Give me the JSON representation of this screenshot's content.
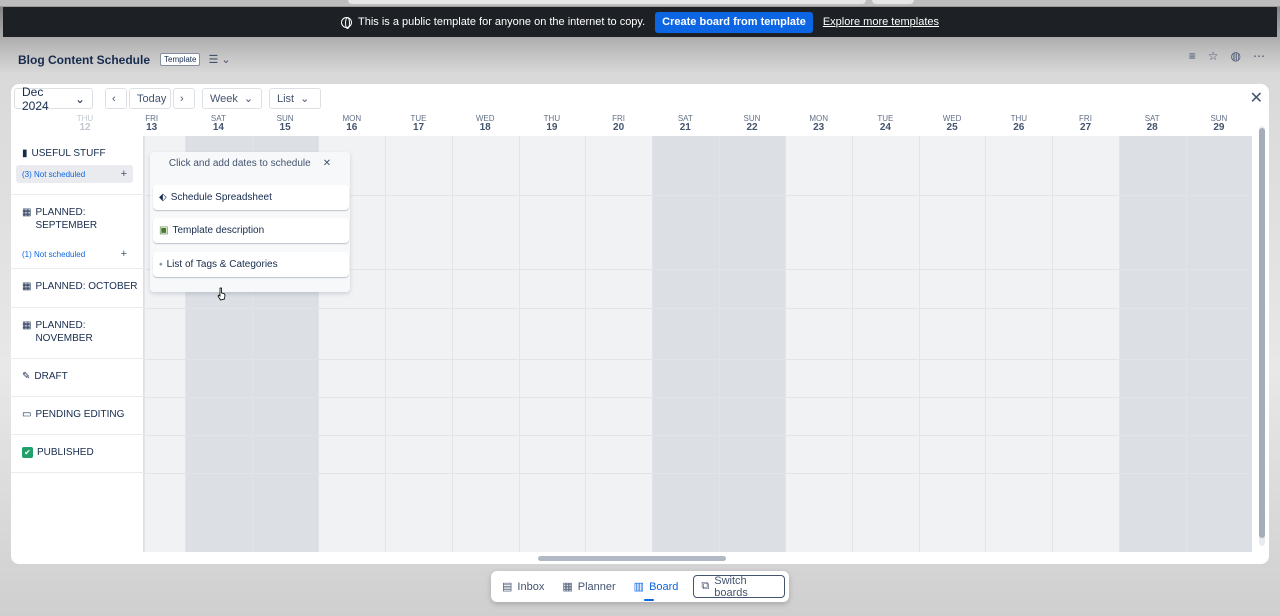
{
  "banner": {
    "message": "This is a public template for anyone on the internet to copy.",
    "create_label": "Create board from template",
    "explore_label": "Explore more templates"
  },
  "board": {
    "title": "Blog Content Schedule",
    "badge": "Template"
  },
  "toolbar": {
    "month": "Dec 2024",
    "today": "Today",
    "view": "Week",
    "mode": "List"
  },
  "days": [
    {
      "d": "THU",
      "n": "12"
    },
    {
      "d": "FRI",
      "n": "13"
    },
    {
      "d": "SAT",
      "n": "14"
    },
    {
      "d": "SUN",
      "n": "15"
    },
    {
      "d": "MON",
      "n": "16"
    },
    {
      "d": "TUE",
      "n": "17"
    },
    {
      "d": "WED",
      "n": "18"
    },
    {
      "d": "THU",
      "n": "19"
    },
    {
      "d": "FRI",
      "n": "20"
    },
    {
      "d": "SAT",
      "n": "21"
    },
    {
      "d": "SUN",
      "n": "22"
    },
    {
      "d": "MON",
      "n": "23"
    },
    {
      "d": "TUE",
      "n": "24"
    },
    {
      "d": "WED",
      "n": "25"
    },
    {
      "d": "THU",
      "n": "26"
    },
    {
      "d": "FRI",
      "n": "27"
    },
    {
      "d": "SAT",
      "n": "28"
    },
    {
      "d": "SUN",
      "n": "29"
    }
  ],
  "lanes": [
    {
      "icon": "▮",
      "title": "USEFUL STUFF",
      "not_scheduled": "(3) Not scheduled"
    },
    {
      "icon": "▦",
      "title": "PLANNED: SEPTEMBER",
      "not_scheduled": "(1) Not scheduled"
    },
    {
      "icon": "▦",
      "title": "PLANNED: OCTOBER"
    },
    {
      "icon": "▦",
      "title": "PLANNED: NOVEMBER"
    },
    {
      "icon": "✎",
      "title": "DRAFT"
    },
    {
      "icon": "▭",
      "title": "PENDING EDITING"
    },
    {
      "icon": "✔",
      "title": "PUBLISHED"
    }
  ],
  "popup": {
    "hint": "Click and add dates to schedule",
    "cards": [
      {
        "icon": "⬖",
        "label": "Schedule Spreadsheet"
      },
      {
        "icon": "▣",
        "label": "Template description"
      },
      {
        "icon": "⬩",
        "label": "List of Tags & Categories"
      }
    ]
  },
  "nav": {
    "inbox": "Inbox",
    "planner": "Planner",
    "board": "Board",
    "switch": "Switch boards"
  },
  "colors": {
    "accent": "#0c66e4",
    "banner_bg": "#1d2125",
    "weekend": "#dcdfe4"
  }
}
